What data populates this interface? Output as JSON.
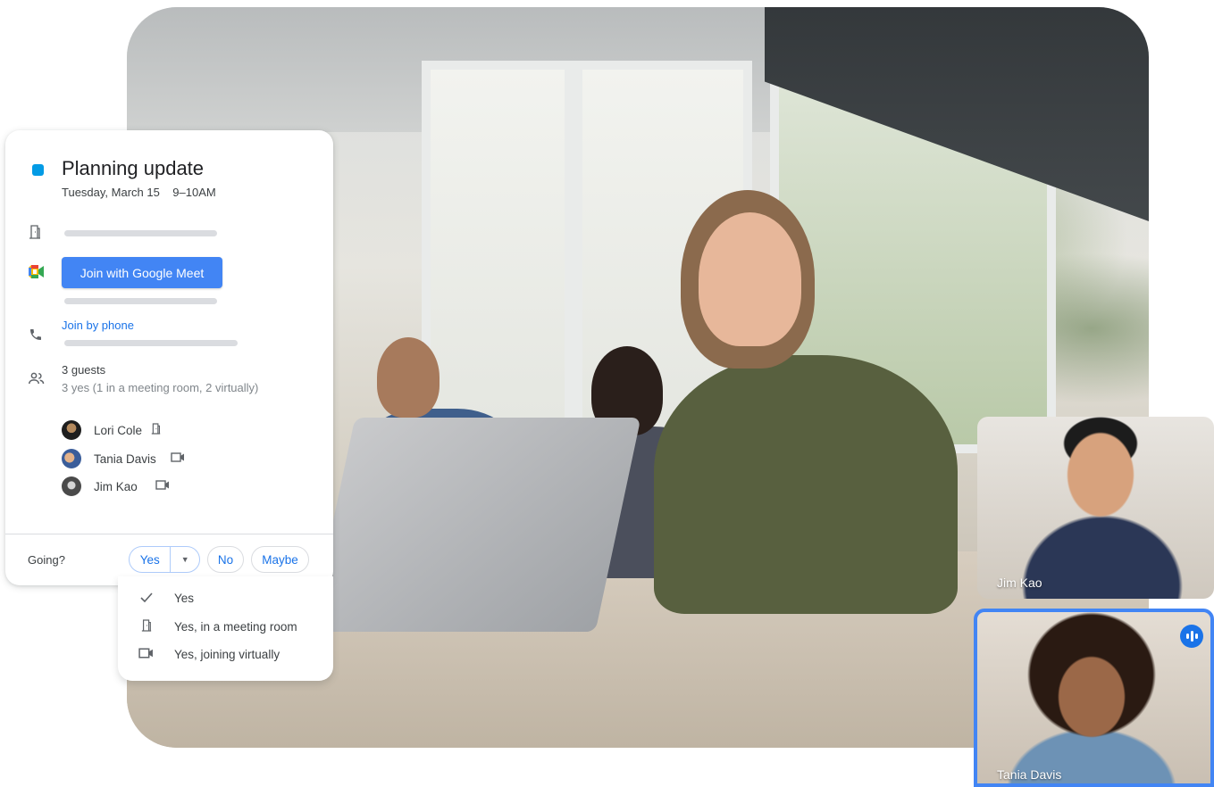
{
  "event": {
    "title": "Planning update",
    "date": "Tuesday, March 15    9–10AM",
    "color": "#039be5",
    "meet_button": "Join with Google Meet",
    "phone_link": "Join by phone",
    "guest_count": "3 guests",
    "guest_summary": "3 yes (1 in a meeting room, 2 virtually)",
    "guests": [
      {
        "name": "Lori Cole",
        "mode_icon": "meeting-room-icon"
      },
      {
        "name": "Tania Davis",
        "mode_icon": "video-icon"
      },
      {
        "name": "Jim Kao",
        "mode_icon": "video-icon"
      }
    ]
  },
  "rsvp": {
    "label": "Going?",
    "yes": "Yes",
    "no": "No",
    "maybe": "Maybe"
  },
  "menu": {
    "items": [
      {
        "label": "Yes",
        "icon": "check-icon"
      },
      {
        "label": "Yes, in a meeting room",
        "icon": "meeting-room-icon"
      },
      {
        "label": "Yes, joining virtually",
        "icon": "video-icon"
      }
    ]
  },
  "tiles": {
    "jim": "Jim Kao",
    "tania": "Tania Davis"
  },
  "colors": {
    "primary": "#4285f4",
    "link": "#1a73e8"
  }
}
